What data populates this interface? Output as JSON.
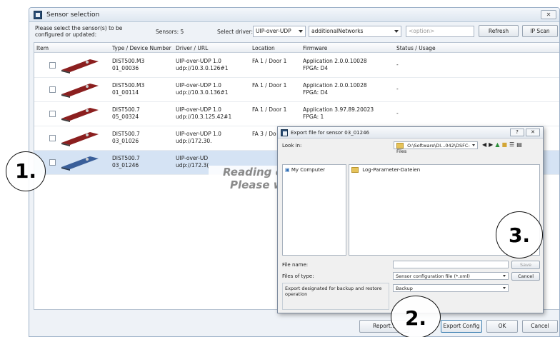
{
  "window": {
    "title": "Sensor selection",
    "close": "✕"
  },
  "toolbar": {
    "prompt": "Please select the sensor(s) to be configured or updated:",
    "sensors_count": "Sensors: 5",
    "driver_label": "Select driver:",
    "driver_value": "UIP-over-UDP",
    "networks_value": "additionalNetworks",
    "option_placeholder": "<option>",
    "refresh": "Refresh",
    "ipscan": "IP Scan"
  },
  "table": {
    "headers": [
      "Item",
      "Type / Device Number",
      "Driver / URL",
      "Location",
      "Firmware",
      "Status / Usage"
    ],
    "rows": [
      {
        "type": "DIST500.M3",
        "dev": "01_00036",
        "driver": "UIP-over-UDP 1.0",
        "url": "udp://10.3.0.126#1",
        "loc": "FA 1 / Door 1",
        "fw1": "Application 2.0.0.10028",
        "fw2": "FPGA: D4",
        "status": "-"
      },
      {
        "type": "DIST500.M3",
        "dev": "01_00114",
        "driver": "UIP-over-UDP 1.0",
        "url": "udp://10.3.0.136#1",
        "loc": "FA 1 / Door 1",
        "fw1": "Application 2.0.0.10028",
        "fw2": "FPGA: D4",
        "status": "-"
      },
      {
        "type": "DIST500.7",
        "dev": "05_00324",
        "driver": "UIP-over-UDP 1.0",
        "url": "udp://10.3.125.42#1",
        "loc": "FA 1 / Door 1",
        "fw1": "Application 3.97.89.20023",
        "fw2": "FPGA: 1",
        "status": "-"
      },
      {
        "type": "DIST500.7",
        "dev": "03_01026",
        "driver": "UIP-over-UDP 1.0",
        "url": "udp://172.30.",
        "loc": "FA 3 / Do",
        "fw1": "",
        "fw2": "",
        "status": ""
      },
      {
        "type": "DIST500.7",
        "dev": "03_01246",
        "driver": "UIP-over-UD",
        "url": "udp://172.3(",
        "loc": "",
        "fw1": "",
        "fw2": "",
        "status": ""
      }
    ]
  },
  "overlay": {
    "line1": "Reading co",
    "line2": "Please w"
  },
  "dialog": {
    "title": "Export file for sensor 03_01246",
    "help": "?",
    "close": "✕",
    "look_in_label": "Look in:",
    "look_in_value": "O:\\Software\\DI...042\\DSFC-Files",
    "places_item": "My Computer",
    "folder_item": "Log-Parameter-Dateien",
    "file_name_label": "File name:",
    "save": "Save",
    "files_type_label": "Files of type:",
    "files_type_value": "Sensor configuration file (*.xml)",
    "cancel": "Cancel",
    "export_label": "Export designated for backup and restore operation",
    "export_value": "Backup"
  },
  "footer": {
    "report": "Report...",
    "export_config": "Export Config",
    "ok": "OK",
    "cancel": "Cancel"
  },
  "callouts": {
    "one": "1.",
    "two": "2.",
    "three": "3."
  }
}
